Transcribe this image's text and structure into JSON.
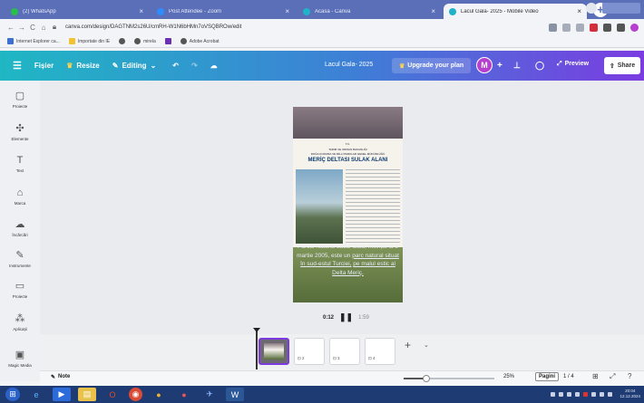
{
  "browser": {
    "tabs": [
      {
        "title": "(2) WhatsApp",
        "fav": "#27c04a"
      },
      {
        "title": "Post Attendee - Zoom",
        "fav": "#2d8cff"
      },
      {
        "title": "Acasă - Canva",
        "fav": "#20b3c8"
      },
      {
        "title": "Lacul Gala- 2025 - Mobile Video",
        "fav": "#20b3c8"
      }
    ],
    "url": "canva.com/design/DAGTNM2s26U/cmRH-W1N6bHMn7oVSQBROw/edit",
    "bookmarks": [
      "Internet Explorer ca...",
      "Importate din IE",
      "mirela",
      "Adobe Acrobat"
    ]
  },
  "header": {
    "menu_label": "Fișier",
    "resize_label": "Resize",
    "editing_label": "Editing",
    "doc_name": "Lacul Gala- 2025",
    "upgrade_label": "Upgrade your plan",
    "avatar_letter": "M",
    "preview_label": "Preview",
    "share_label": "Share"
  },
  "rail": [
    {
      "label": "Proiecte",
      "icon": "layout-icon",
      "glyph": "▢"
    },
    {
      "label": "Elemente",
      "icon": "elements-icon",
      "glyph": "✣"
    },
    {
      "label": "Text",
      "icon": "text-icon",
      "glyph": "T"
    },
    {
      "label": "Marca",
      "icon": "brand-icon",
      "glyph": "⌂"
    },
    {
      "label": "Încărcări",
      "icon": "upload-icon",
      "glyph": "☁"
    },
    {
      "label": "Instrumente",
      "icon": "draw-icon",
      "glyph": "✎"
    },
    {
      "label": "Proiecte",
      "icon": "folder-icon",
      "glyph": "▭"
    },
    {
      "label": "Aplicații",
      "icon": "apps-icon",
      "glyph": "⁂"
    },
    {
      "label": "Magic Media",
      "icon": "magic-media-icon",
      "glyph": "▣"
    }
  ],
  "page": {
    "sign_line1": "T.C.",
    "sign_line2": "TARIM VE ORMAN BAKANLIĞI",
    "sign_line3": "DOĞA KORUMA VE MİLLİ PARKLAR GENEL MÜDÜRLÜĞÜ",
    "sign_title": "MERİÇ DELTASI SULAK ALANI",
    "caption_a": "Parcul Natural Lacul Gala, înființat la 5 martie 2005, este un",
    "caption_b": "parc natural situat",
    "caption_c": "în sud-estul Turciei,",
    "caption_d": "pe malul estic al Delta Meriç."
  },
  "playback": {
    "current": "0:12",
    "total": "1:59"
  },
  "timeline": {
    "page_labels": [
      "",
      "2",
      "3",
      "4"
    ]
  },
  "footer": {
    "note_label": "Note",
    "zoom": "25%",
    "zoom_fraction": 0.25,
    "pages_label": "Pagini",
    "page_counter": "1 / 4"
  },
  "taskbar": {
    "time": "20:04",
    "date": "12.12.2024"
  }
}
